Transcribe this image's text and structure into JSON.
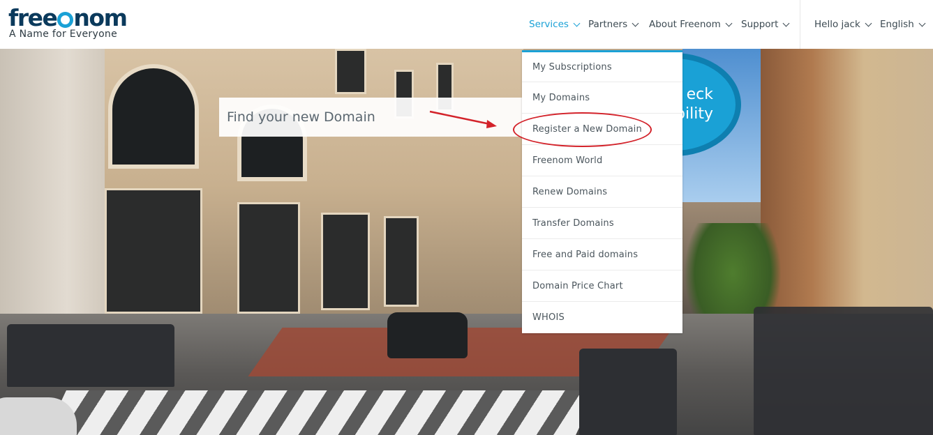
{
  "logo": {
    "word_a": "free",
    "word_b": "nom",
    "tagline": "A Name for Everyone"
  },
  "nav": {
    "services": "Services",
    "partners": "Partners",
    "about": "About Freenom",
    "support": "Support",
    "greeting": "Hello jack",
    "language": "English"
  },
  "hero": {
    "search_placeholder": "Find your new Domain",
    "check_line1": "eck",
    "check_line2": "bility"
  },
  "services_menu": {
    "items": [
      "My Subscriptions",
      "My Domains",
      "Register a New Domain",
      "Freenom World",
      "Renew Domains",
      "Transfer Domains",
      "Free and Paid domains",
      "Domain Price Chart",
      "WHOIS"
    ]
  },
  "colors": {
    "accent": "#1aa1d6",
    "logo_dark": "#0b3a5c",
    "annotation": "#d3222a"
  },
  "icons": [
    "chevron-down-icon",
    "logo-o-ring"
  ]
}
